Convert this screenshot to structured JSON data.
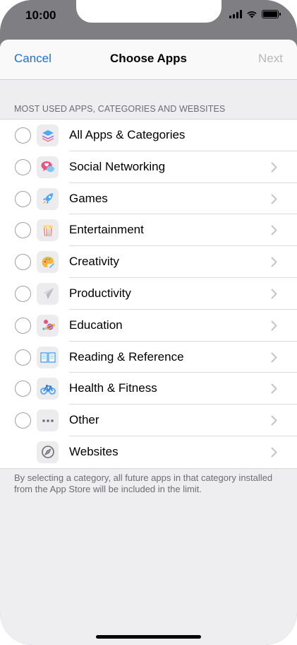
{
  "status_bar": {
    "time": "10:00"
  },
  "nav": {
    "cancel": "Cancel",
    "title": "Choose Apps",
    "next": "Next"
  },
  "section_header": "MOST USED APPS, CATEGORIES AND WEBSITES",
  "rows": [
    {
      "label": "All Apps & Categories",
      "icon": "stack-icon",
      "has_radio": true,
      "has_chevron": false
    },
    {
      "label": "Social Networking",
      "icon": "speech-bubbles-icon",
      "has_radio": true,
      "has_chevron": true
    },
    {
      "label": "Games",
      "icon": "rocket-icon",
      "has_radio": true,
      "has_chevron": true
    },
    {
      "label": "Entertainment",
      "icon": "popcorn-icon",
      "has_radio": true,
      "has_chevron": true
    },
    {
      "label": "Creativity",
      "icon": "palette-icon",
      "has_radio": true,
      "has_chevron": true
    },
    {
      "label": "Productivity",
      "icon": "paper-plane-icon",
      "has_radio": true,
      "has_chevron": true
    },
    {
      "label": "Education",
      "icon": "planet-icon",
      "has_radio": true,
      "has_chevron": true
    },
    {
      "label": "Reading & Reference",
      "icon": "book-icon",
      "has_radio": true,
      "has_chevron": true
    },
    {
      "label": "Health & Fitness",
      "icon": "bicycle-icon",
      "has_radio": true,
      "has_chevron": true
    },
    {
      "label": "Other",
      "icon": "ellipsis-icon",
      "has_radio": true,
      "has_chevron": true
    },
    {
      "label": "Websites",
      "icon": "compass-icon",
      "has_radio": false,
      "has_chevron": true
    }
  ],
  "footer_note": "By selecting a category, all future apps in that category installed from the App Store will be included in the limit.",
  "colors": {
    "accent": "#1a6fd6",
    "disabled": "#b8b8bc",
    "background": "#eeeef1"
  }
}
